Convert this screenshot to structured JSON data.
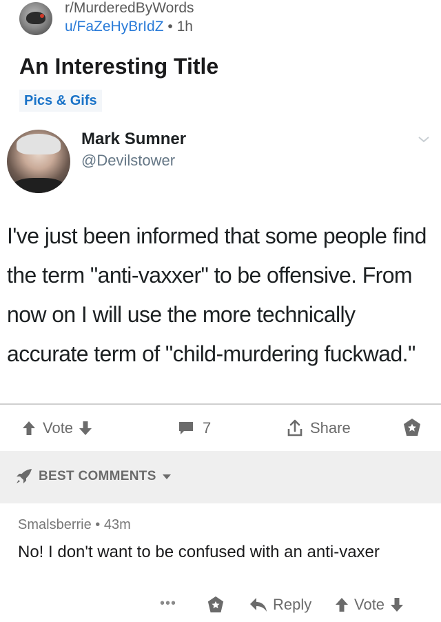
{
  "post": {
    "subreddit": "r/MurderedByWords",
    "author": "u/FaZeHyBrIdZ",
    "separator": " • ",
    "age": "1h",
    "title": "An Interesting Title",
    "flair": "Pics & Gifs"
  },
  "tweet": {
    "name": "Mark Sumner",
    "handle": "@Devilstower",
    "text": "I've just been informed that some people find the term \"anti-vaxxer\" to be offensive. From now on I will use the more technically accurate term of \"child-murdering fuckwad.\""
  },
  "actions": {
    "vote_label": "Vote",
    "comment_count": "7",
    "share_label": "Share"
  },
  "comments_bar": {
    "label": "BEST COMMENTS"
  },
  "comment": {
    "author": "Smalsberrie",
    "separator": " • ",
    "age": "43m",
    "body": "No! I don't want to be confused with an anti-vaxer",
    "more_label": "•••",
    "reply_label": "Reply",
    "vote_label": "Vote"
  },
  "icons": {
    "upvote": "up-arrow-icon",
    "downvote": "down-arrow-icon",
    "comment": "comment-bubble-icon",
    "share": "share-icon",
    "save": "save-star-icon",
    "rocket": "rocket-icon",
    "reply": "reply-arrow-icon",
    "chevron": "chevron-down-icon"
  },
  "colors": {
    "link_blue": "#2a7bd8",
    "flair_text": "#1a73c8",
    "flair_bg": "#f3f6f9",
    "muted": "#6b6b6b",
    "bar_bg": "#efefef"
  }
}
